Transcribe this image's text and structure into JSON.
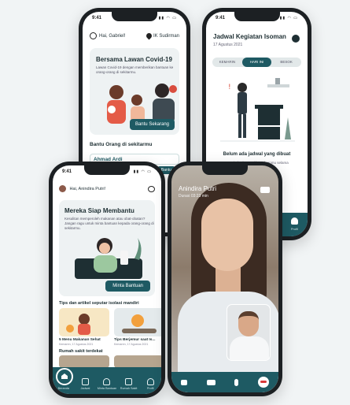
{
  "status": {
    "time": "9:41"
  },
  "home": {
    "greeting": "Hai, Gabriel!",
    "location": "IK Sudirman",
    "card_title": "Bersama Lawan Covid-19",
    "card_text": "Lawan Covid-19 dengan memberikan bantuan ke orang-orang di sekitarmu.",
    "card_button": "Bantu Sekarang",
    "section": "Bantu Orang di sekitarmu",
    "person_name": "Ahmad Ardi",
    "person_button": "Bantu"
  },
  "schedule": {
    "title": "Jadwal Kegiatan Isoman",
    "date": "17 Agustus 2021",
    "tabs": [
      "KEMARIN",
      "HARI INI",
      "BESOK"
    ],
    "empty_title": "Belum ada jadwal yang dibuat",
    "empty_hint": "Buat jadwal sesuai keperluanmu selama menjalani isolasi mandiri.",
    "nav_profile": "Profil"
  },
  "patient": {
    "greeting": "Hai, Anindira Putri!",
    "card_title": "Mereka Siap Membantu",
    "card_text": "Kesulitan memperoleh makanan atau obat-obatan? Jangan ragu untuk minta bantuan kepada orang-orang di sekitarmu.",
    "card_button": "Minta Bantuan",
    "articles_title": "Tips dan artikel seputar isolasi mandiri",
    "articles": [
      {
        "title": "5 Menu Makanan Sehat",
        "date": "Kemaren, 17 Agustus 2021"
      },
      {
        "title": "Tips Berjemur saat Is...",
        "date": "Kemaren, 17 Agustus 2021"
      }
    ],
    "hospitals_title": "Rumah sakit terdekat",
    "nav": [
      "Beranda",
      "Jadwal",
      "Minta Bantuan",
      "Rumah Sakit",
      "Profil"
    ]
  },
  "call": {
    "name": "Anindira Putri",
    "duration": "Durasi 03:23 min"
  }
}
